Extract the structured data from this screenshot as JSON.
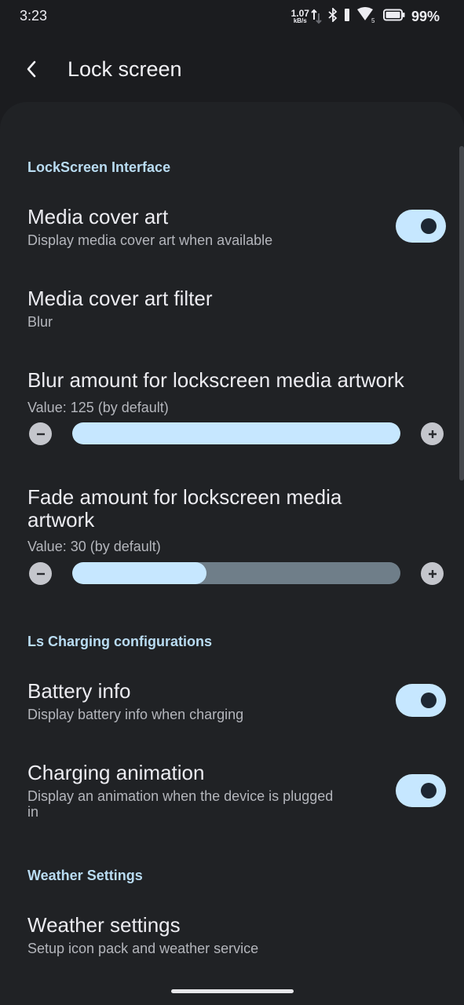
{
  "status": {
    "time": "3:23",
    "net_speed": "1.07",
    "net_unit": "kB/s",
    "battery": "99%",
    "icons": [
      "bluetooth-icon",
      "vibrate-icon",
      "wifi-icon",
      "battery-icon"
    ]
  },
  "appbar": {
    "title": "Lock screen",
    "back_icon": "back-arrow-icon"
  },
  "sections": {
    "lockscreen": "LockScreen Interface",
    "charging": "Ls Charging configurations",
    "weather": "Weather Settings"
  },
  "items": {
    "media_cover_art": {
      "title": "Media cover art",
      "subtitle": "Display media cover art when available",
      "enabled": true
    },
    "media_cover_art_filter": {
      "title": "Media cover art filter",
      "subtitle": "Blur"
    },
    "blur_amount": {
      "title": "Blur amount for lockscreen media artwork",
      "value_text": "Value: 125 (by default)",
      "value": 125,
      "fraction": 1.0
    },
    "fade_amount": {
      "title_line1": "Fade amount for lockscreen media",
      "title_line2": "artwork",
      "value_text": "Value: 30 (by default)",
      "value": 30,
      "fraction": 0.41
    },
    "battery_info": {
      "title": "Battery info",
      "subtitle": "Display battery info when charging",
      "enabled": true
    },
    "charging_animation": {
      "title": "Charging animation",
      "subtitle_line1": "Display an animation when the device is plugged",
      "subtitle_line2": "in",
      "enabled": true
    },
    "weather_settings": {
      "title": "Weather settings",
      "subtitle": "Setup icon pack and weather service"
    }
  },
  "colors": {
    "background": "#1b1c1f",
    "card": "#202225",
    "accent": "#c6e7ff",
    "section_title": "#b9dcf2",
    "track": "#6f7e89"
  }
}
